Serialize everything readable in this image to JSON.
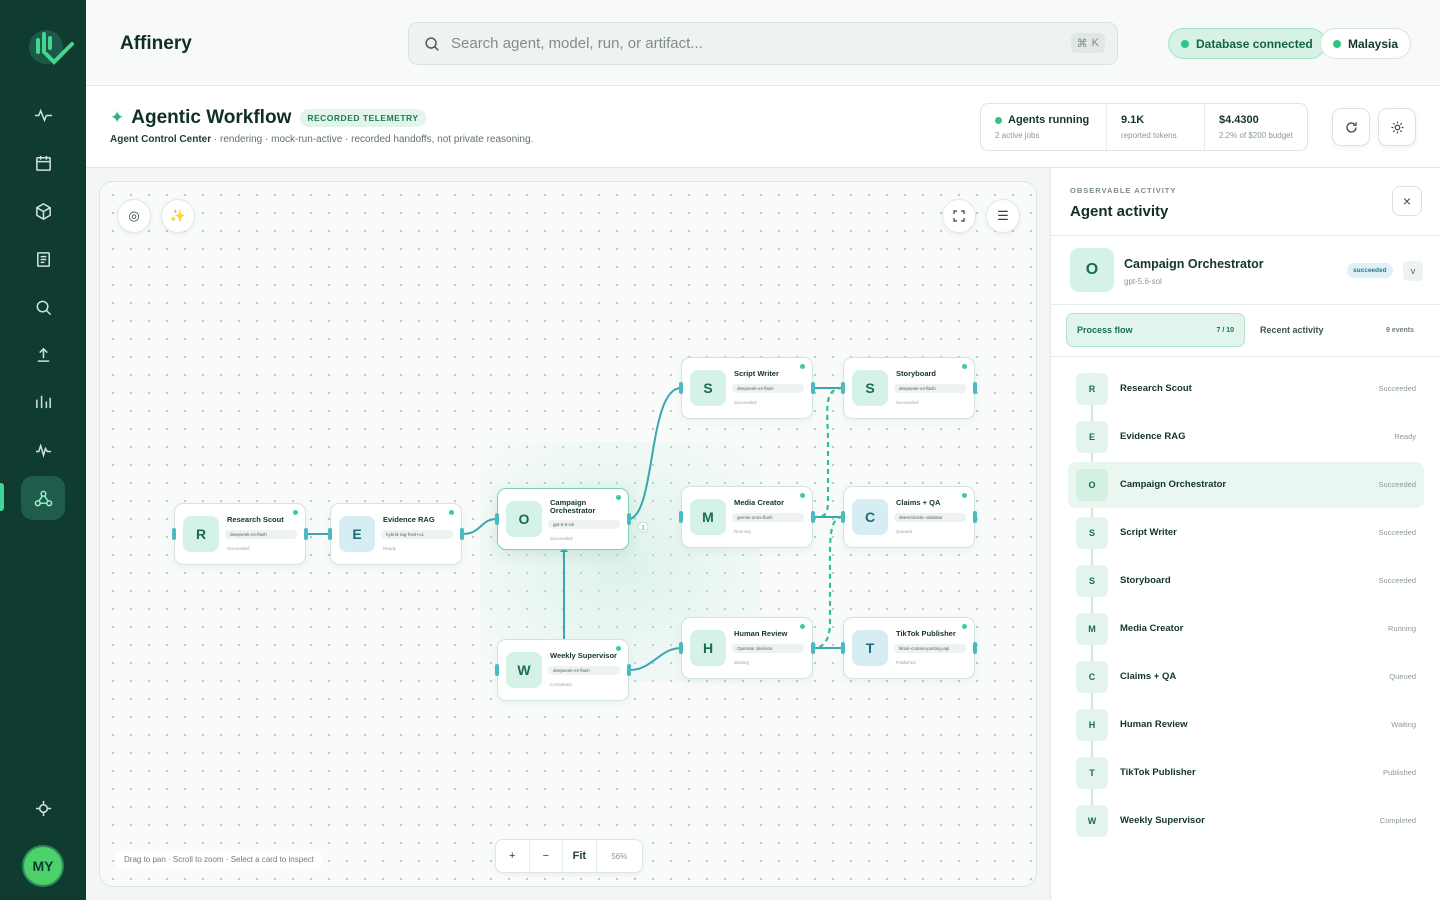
{
  "brand": "Affinery",
  "search": {
    "placeholder": "Search agent, model, run, or artifact...",
    "shortcut_symbol": "⌘",
    "shortcut_key": "K"
  },
  "status_pills": {
    "database": "Database connected",
    "region": "Malaysia"
  },
  "sidebar": {
    "items": [
      {
        "icon": "activity-icon"
      },
      {
        "icon": "calendar-icon"
      },
      {
        "icon": "cube-icon"
      },
      {
        "icon": "document-icon"
      },
      {
        "icon": "search-icon"
      },
      {
        "icon": "upload-icon"
      },
      {
        "icon": "bar-chart-icon"
      },
      {
        "icon": "pulse-icon"
      },
      {
        "icon": "workflow-icon",
        "active": true
      }
    ],
    "bottom_icon": "target-icon",
    "avatar_initials": "MY"
  },
  "header": {
    "title": "Agentic Workflow",
    "badge": "RECORDED TELEMETRY",
    "subtitle_bold": "Agent Control Center",
    "subtitle_rest": " · rendering · mock-run-active · recorded handoffs, not private reasoning.",
    "stats": [
      {
        "value": "Agents running",
        "sub": "2 active jobs"
      },
      {
        "value": "9.1K",
        "sub": "reported tokens"
      },
      {
        "value": "$4.4300",
        "sub": "2.2% of $200 budget"
      }
    ]
  },
  "canvas": {
    "hint": "Drag to pan · Scroll to zoom · Select a card to inspect",
    "zoom": {
      "in": "+",
      "out": "−",
      "fit": "Fit",
      "level": "56%"
    },
    "edge_count_label": "1",
    "nodes": {
      "research": {
        "letter": "R",
        "name": "Research Scout",
        "model": "deepseek-v4-flash",
        "status": "Succeeded"
      },
      "evidence": {
        "letter": "E",
        "name": "Evidence RAG",
        "model": "hybrid-rag-fresh-v1",
        "status": "Ready"
      },
      "orchestrator": {
        "letter": "O",
        "name": "Campaign Orchestrator",
        "model": "gpt-5.6-sol",
        "status": "Succeeded"
      },
      "script": {
        "letter": "S",
        "name": "Script Writer",
        "model": "deepseek-v4-flash",
        "status": "Succeeded"
      },
      "storyboard": {
        "letter": "S",
        "name": "Storyboard",
        "model": "deepseek-v4-flash",
        "status": "Succeeded"
      },
      "media": {
        "letter": "M",
        "name": "Media Creator",
        "model": "gemini-omni-flash",
        "status": "Running"
      },
      "claims": {
        "letter": "C",
        "name": "Claims + QA",
        "model": "deterministic-validator",
        "status": "Queued"
      },
      "human": {
        "letter": "H",
        "name": "Human Review",
        "model": "Operator decision",
        "status": "Waiting"
      },
      "tiktok": {
        "letter": "T",
        "name": "TikTok Publisher",
        "model": "tiktok-content-posting-api",
        "status": "Published"
      },
      "weekly": {
        "letter": "W",
        "name": "Weekly Supervisor",
        "model": "deepseek-v4-flash",
        "status": "Completed"
      }
    }
  },
  "panel": {
    "eyebrow": "OBSERVABLE ACTIVITY",
    "title": "Agent activity",
    "close": "×",
    "selected": {
      "letter": "O",
      "name": "Campaign Orchestrator",
      "model": "gpt-5.6-sol",
      "status": "succeeded",
      "chevron": "v"
    },
    "tabs": [
      {
        "label": "Process flow",
        "count": "7 / 10"
      },
      {
        "label": "Recent activity",
        "count": "9 events"
      }
    ],
    "flow": [
      {
        "letter": "R",
        "name": "Research Scout",
        "status": "Succeeded"
      },
      {
        "letter": "E",
        "name": "Evidence RAG",
        "status": "Ready"
      },
      {
        "letter": "O",
        "name": "Campaign Orchestrator",
        "status": "Succeeded",
        "selected": true
      },
      {
        "letter": "S",
        "name": "Script Writer",
        "status": "Succeeded"
      },
      {
        "letter": "S",
        "name": "Storyboard",
        "status": "Succeeded"
      },
      {
        "letter": "M",
        "name": "Media Creator",
        "status": "Running"
      },
      {
        "letter": "C",
        "name": "Claims + QA",
        "status": "Queued"
      },
      {
        "letter": "H",
        "name": "Human Review",
        "status": "Waiting"
      },
      {
        "letter": "T",
        "name": "TikTok Publisher",
        "status": "Published"
      },
      {
        "letter": "W",
        "name": "Weekly Supervisor",
        "status": "Completed"
      }
    ]
  },
  "colors": {
    "sidebar": "#0f3b31",
    "accent": "#2fc482",
    "edge": "#3aa7b3",
    "edge_dashed": "#2fc482"
  }
}
